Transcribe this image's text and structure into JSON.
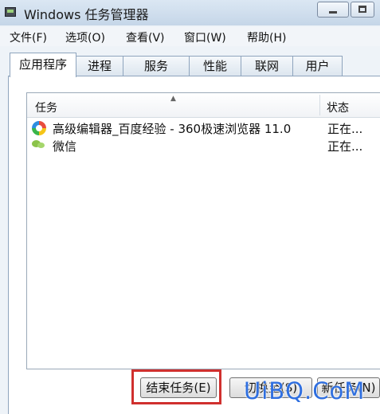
{
  "window": {
    "title": "Windows 任务管理器"
  },
  "menu": [
    "文件(F)",
    "选项(O)",
    "查看(V)",
    "窗口(W)",
    "帮助(H)"
  ],
  "tabs": [
    "应用程序",
    "进程",
    "服务",
    "性能",
    "联网",
    "用户"
  ],
  "active_tab": "应用程序",
  "columns": {
    "task": "任务",
    "status": "状态"
  },
  "rows": [
    {
      "name": "高级编辑器_百度经验 - 360极速浏览器 11.0",
      "status": "正在...",
      "icon": "360-browser-icon"
    },
    {
      "name": "微信",
      "status": "正在...",
      "icon": "wechat-icon"
    }
  ],
  "buttons": {
    "end_task": "结束任务(E)",
    "switch_to": "切换至(S)",
    "new_task": "新任务(N)"
  },
  "watermark": "UiBQ.CoM",
  "colors": {
    "highlight": "#d0302e",
    "watermark": "#2f6fe0"
  }
}
